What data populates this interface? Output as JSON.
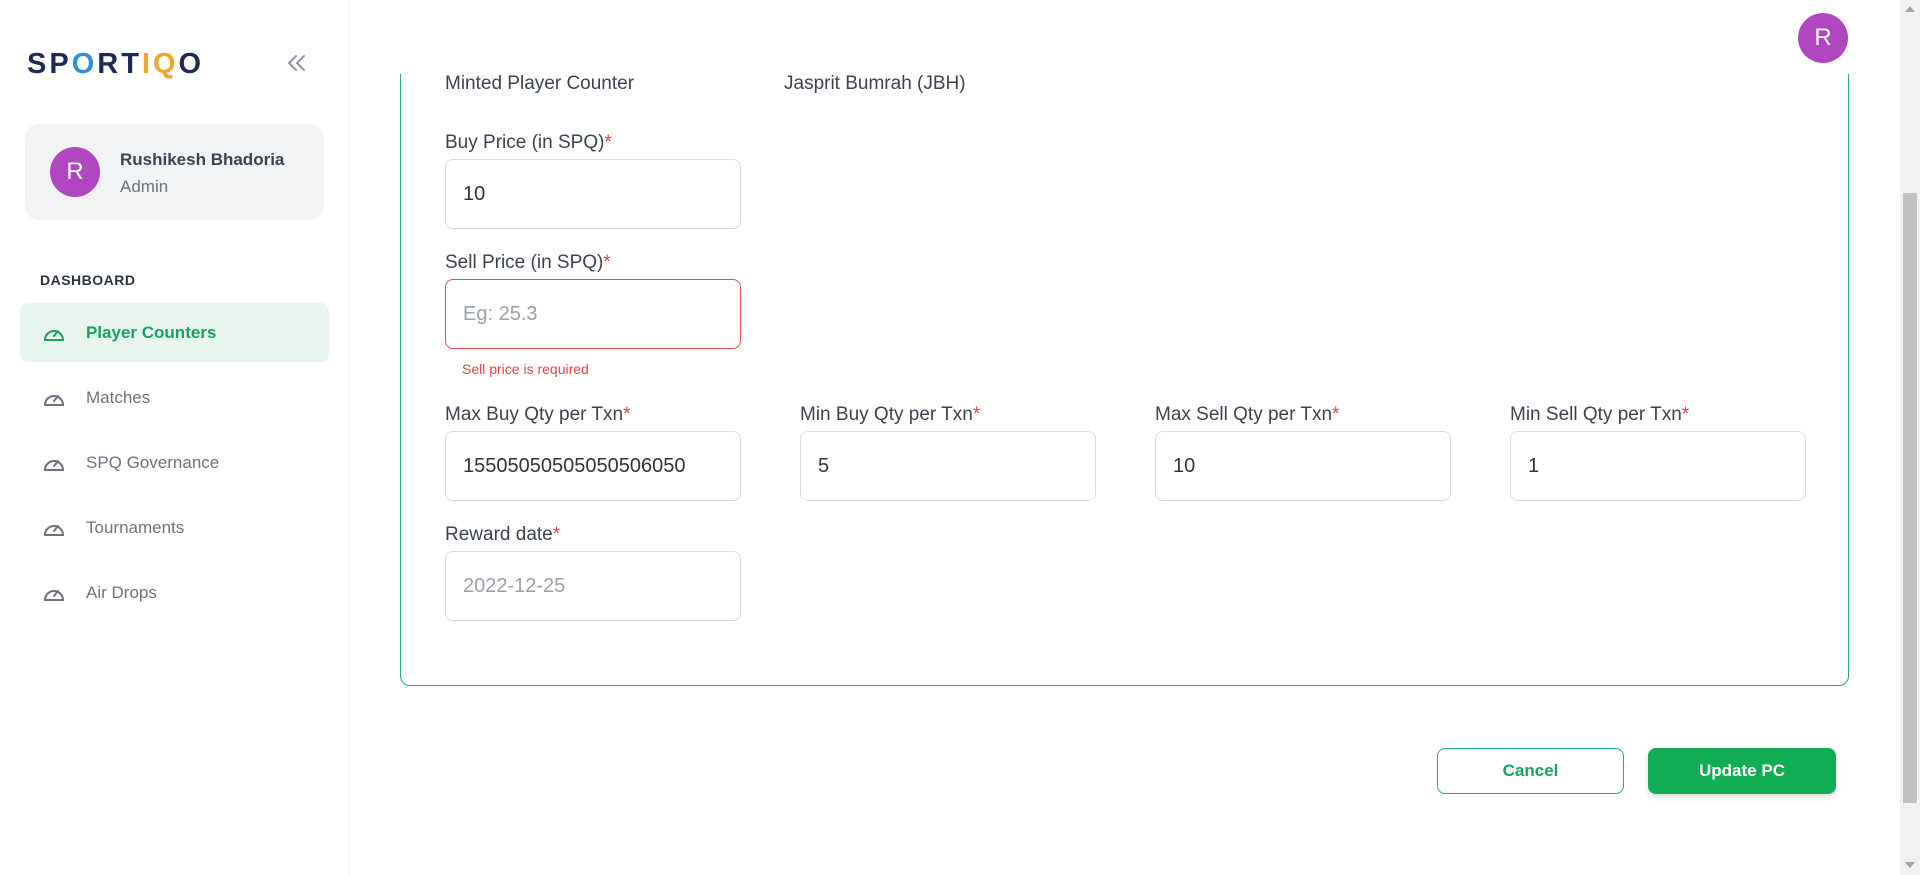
{
  "brand": {
    "logo_parts": [
      "SP",
      "O",
      "RT",
      "IQ",
      "O"
    ],
    "accent_color": "#10ad55",
    "avatar_color": "#b046c0"
  },
  "sidebar": {
    "collapse_icon": "chevrons-left-icon",
    "user": {
      "initial": "R",
      "name": "Rushikesh Bhadoria",
      "role": "Admin"
    },
    "section_title": "DASHBOARD",
    "items": [
      {
        "label": "Player Counters",
        "icon": "speedometer-icon",
        "active": true
      },
      {
        "label": "Matches",
        "icon": "speedometer-icon",
        "active": false
      },
      {
        "label": "SPQ Governance",
        "icon": "speedometer-icon",
        "active": false
      },
      {
        "label": "Tournaments",
        "icon": "speedometer-icon",
        "active": false
      },
      {
        "label": "Air Drops",
        "icon": "speedometer-icon",
        "active": false
      }
    ]
  },
  "header": {
    "avatar_initial": "R"
  },
  "form": {
    "player_counter_label": "Minted Player Counter",
    "player_counter_value": "Jasprit Bumrah (JBH)",
    "required_mark": "*",
    "buy_price": {
      "label": "Buy Price (in SPQ)",
      "value": "10",
      "placeholder": ""
    },
    "sell_price": {
      "label": "Sell Price (in SPQ)",
      "value": "",
      "placeholder": "Eg: 25.3",
      "error": "Sell price is required"
    },
    "max_buy_qty": {
      "label": "Max Buy Qty per Txn",
      "value": "15505050505050506050"
    },
    "min_buy_qty": {
      "label": "Min Buy Qty per Txn",
      "value": "5"
    },
    "max_sell_qty": {
      "label": "Max Sell Qty per Txn",
      "value": "10"
    },
    "min_sell_qty": {
      "label": "Min Sell Qty per Txn",
      "value": "1"
    },
    "reward_date": {
      "label": "Reward date",
      "value": "",
      "placeholder": "2022-12-25"
    }
  },
  "actions": {
    "cancel_label": "Cancel",
    "update_label": "Update PC"
  }
}
